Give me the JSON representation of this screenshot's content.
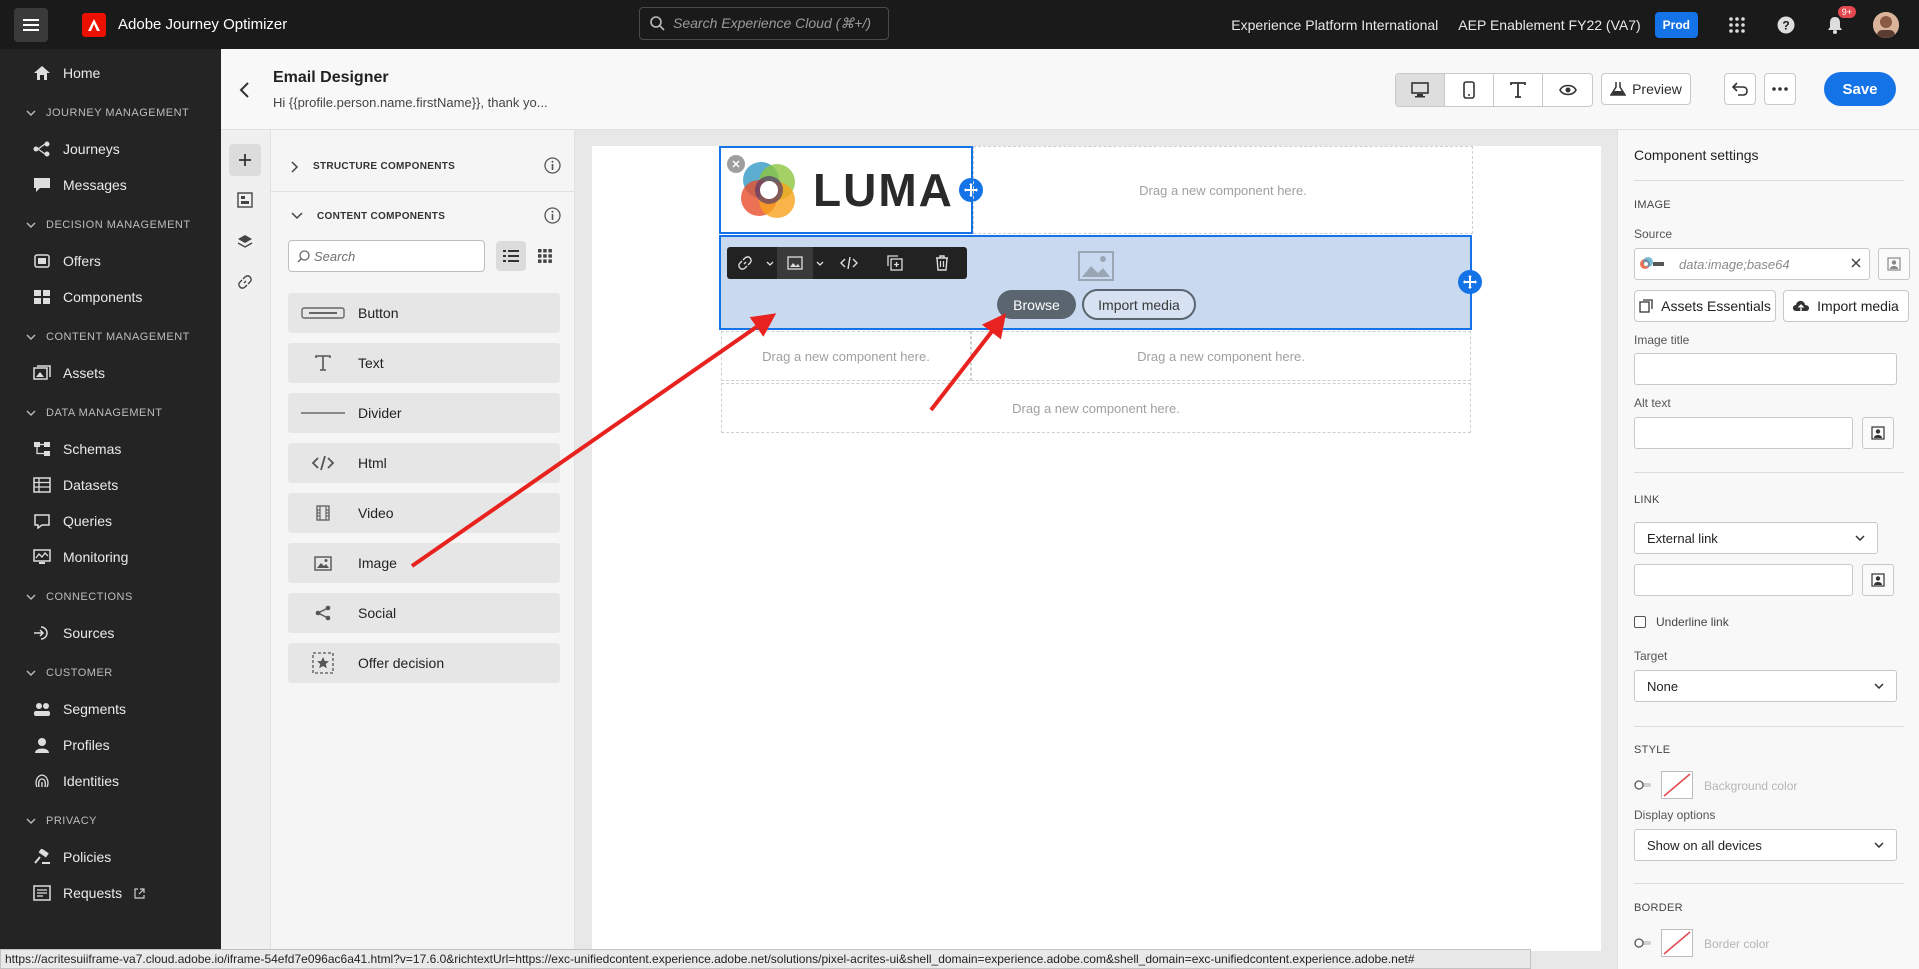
{
  "topbar": {
    "app_title": "Adobe Journey Optimizer",
    "search_placeholder": "Search Experience Cloud (⌘+/)",
    "org": "Experience Platform International",
    "sandbox": "AEP Enablement FY22 (VA7)",
    "env_badge": "Prod",
    "notification_count": "9+"
  },
  "sidebar": {
    "home": "Home",
    "sections": {
      "journey": "JOURNEY MANAGEMENT",
      "decision": "DECISION MANAGEMENT",
      "content": "CONTENT MANAGEMENT",
      "data": "DATA MANAGEMENT",
      "connections": "CONNECTIONS",
      "customer": "CUSTOMER",
      "privacy": "PRIVACY"
    },
    "items": {
      "journeys": "Journeys",
      "messages": "Messages",
      "offers": "Offers",
      "components": "Components",
      "assets": "Assets",
      "schemas": "Schemas",
      "datasets": "Datasets",
      "queries": "Queries",
      "monitoring": "Monitoring",
      "sources": "Sources",
      "segments": "Segments",
      "profiles": "Profiles",
      "identities": "Identities",
      "policies": "Policies",
      "requests": "Requests"
    }
  },
  "header": {
    "title": "Email Designer",
    "subtitle": "Hi {{profile.person.name.firstName}}, thank yo...",
    "preview": "Preview",
    "save": "Save"
  },
  "components_panel": {
    "structure_label": "STRUCTURE COMPONENTS",
    "content_label": "CONTENT COMPONENTS",
    "search_placeholder": "Search",
    "items": [
      "Button",
      "Text",
      "Divider",
      "Html",
      "Video",
      "Image",
      "Social",
      "Offer decision"
    ]
  },
  "canvas": {
    "logo_text": "LUMA",
    "drop_hint": "Drag a new component here.",
    "browse": "Browse",
    "import_media": "Import media"
  },
  "settings": {
    "title": "Component settings",
    "image_section": "IMAGE",
    "source_label": "Source",
    "source_value": "data:image;base64",
    "assets_essentials": "Assets Essentials",
    "import_media": "Import media",
    "image_title_label": "Image title",
    "alt_text_label": "Alt text",
    "link_section": "LINK",
    "link_type": "External link",
    "underline_link": "Underline link",
    "target_label": "Target",
    "target_value": "None",
    "style_section": "STYLE",
    "background_color": "Background color",
    "display_options_label": "Display options",
    "display_options_value": "Show on all devices",
    "border_section": "BORDER",
    "border_color": "Border color"
  },
  "statusbar": {
    "url": "https://acritesuiiframe-va7.cloud.adobe.io/iframe-54efd7e096ac6a41.html?v=17.6.0&richtextUrl=https://exc-unifiedcontent.experience.adobe.net/solutions/pixel-acrites-ui&shell_domain=experience.adobe.com&shell_domain=exc-unifiedcontent.experience.adobe.net#"
  },
  "colors": {
    "accent": "#1473e6",
    "annotation_arrow": "#e8231f",
    "topbar_bg": "#1a1a1a",
    "sidebar_bg": "#242424"
  }
}
